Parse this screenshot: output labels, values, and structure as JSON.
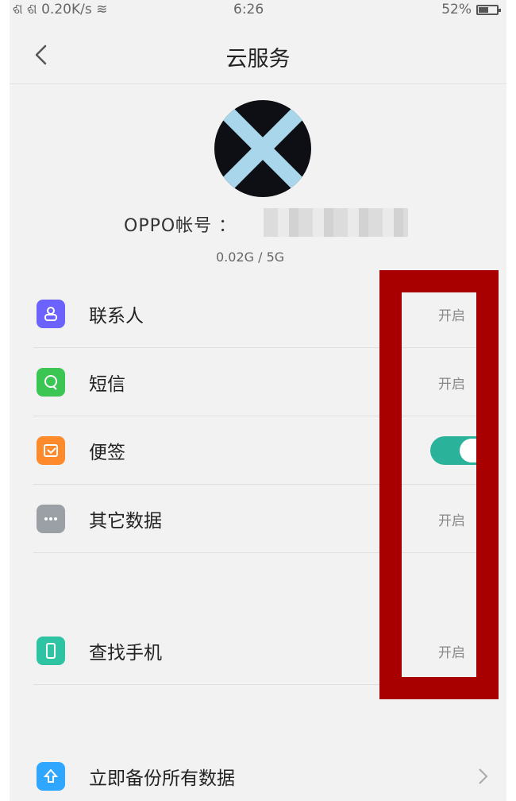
{
  "status_bar": {
    "left": "ଶ ଶ 0.20K/s ≋",
    "time": "6:26",
    "battery": "52%"
  },
  "header": {
    "title": "云服务"
  },
  "profile": {
    "account_label": "OPPO帐号 ：",
    "storage": "0.02G / 5G"
  },
  "items": [
    {
      "label": "联系人",
      "status": "开启",
      "color": "#6c63ff"
    },
    {
      "label": "短信",
      "status": "开启",
      "color": "#3bc553"
    },
    {
      "label": "便签",
      "toggle": true,
      "color": "#ff8a2b"
    },
    {
      "label": "其它数据",
      "status": "开启",
      "color": "#9aa0a6"
    },
    {
      "label": "查找手机",
      "status": "开启",
      "color": "#2ec3a2"
    },
    {
      "label": "立即备份所有数据",
      "color": "#2fa6ff"
    }
  ]
}
